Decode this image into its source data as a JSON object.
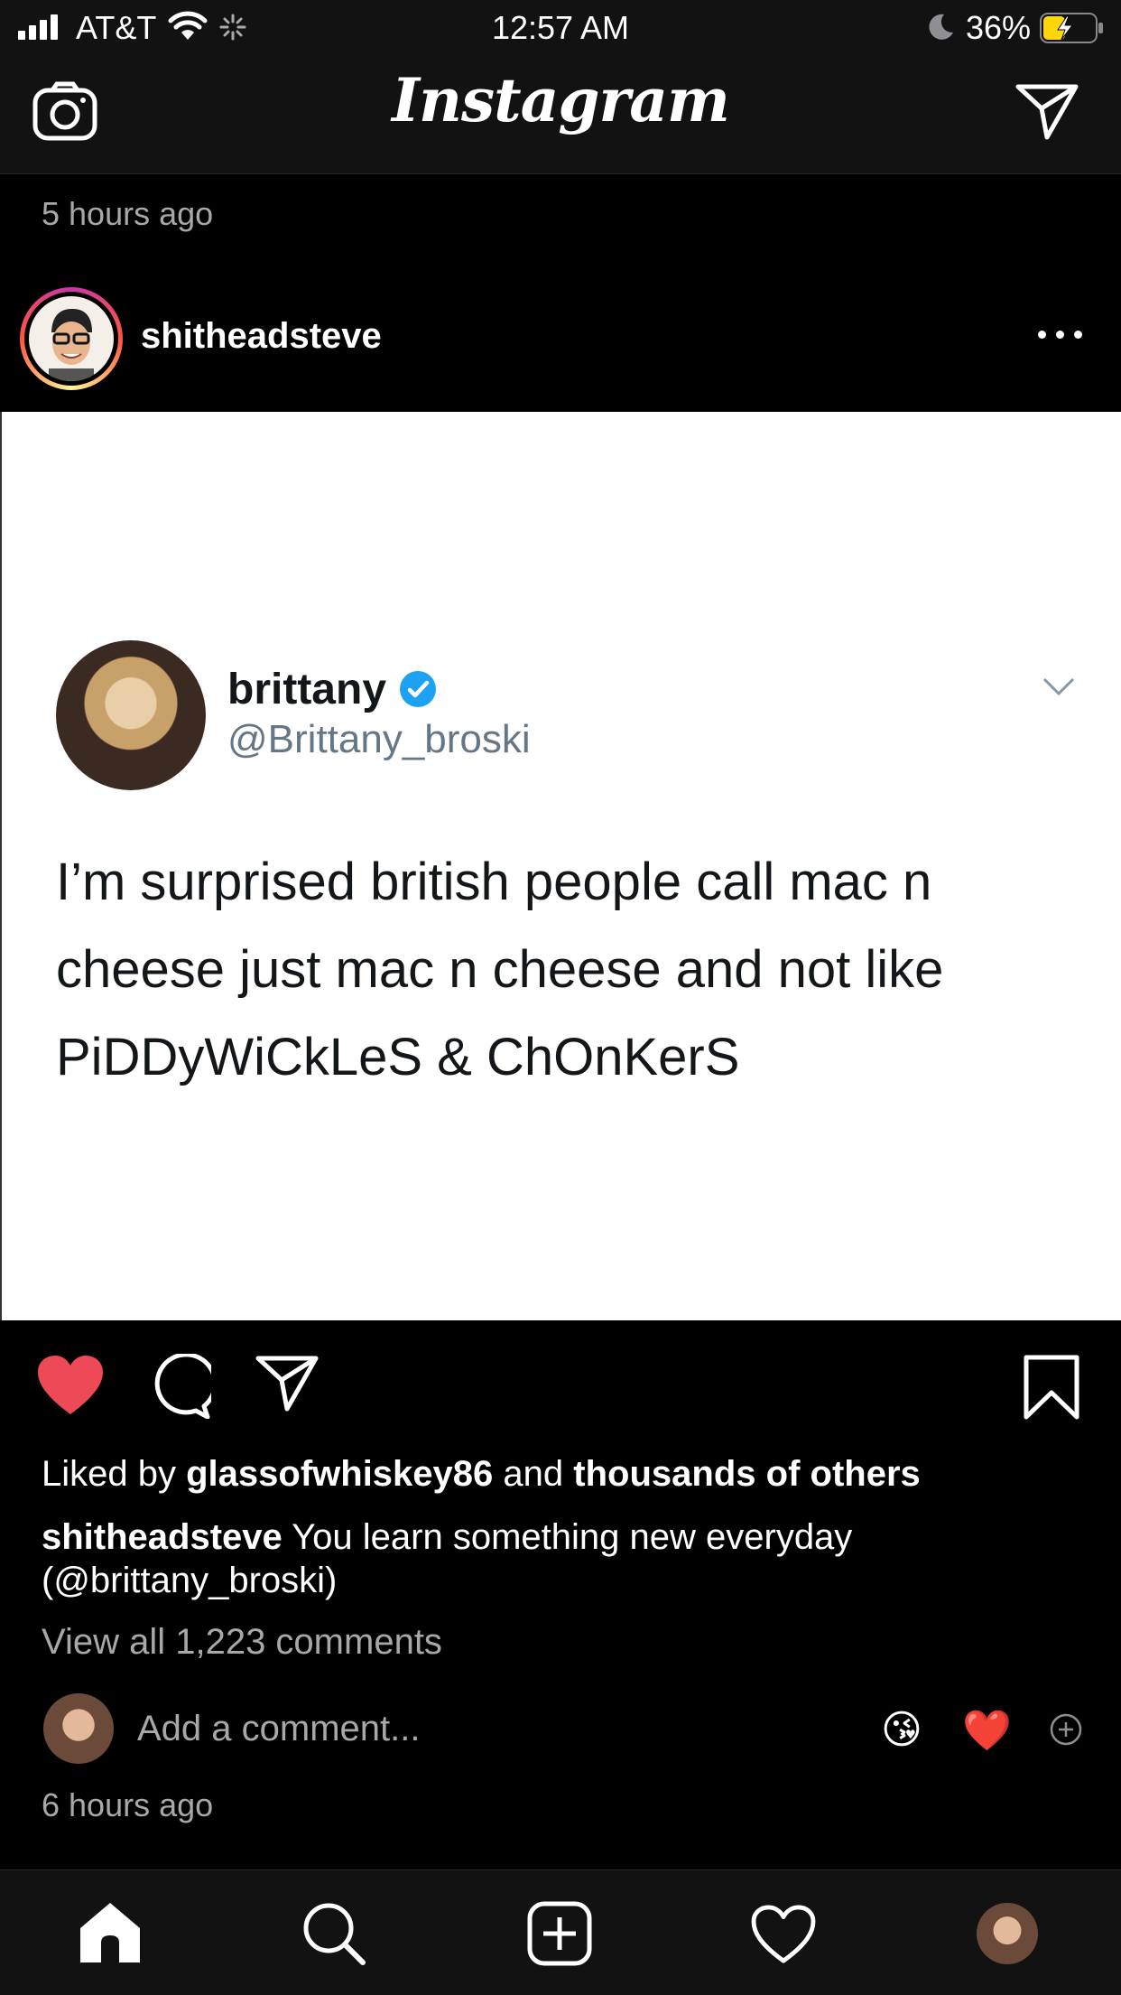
{
  "status_bar": {
    "carrier": "AT&T",
    "time": "12:57 AM",
    "battery": "36%"
  },
  "header": {
    "logo": "Instagram",
    "icons": [
      "camera-icon",
      "direct-message-icon"
    ]
  },
  "previous_post": {
    "timestamp": "5 hours ago"
  },
  "post": {
    "username": "shitheadsteve",
    "tweet": {
      "name": "brittany",
      "handle": "@Brittany_broski",
      "text": "I’m surprised british people call mac n cheese just mac n cheese and not like PiDDyWiCkLeS & ChOnKerS",
      "verified_color": "#1da1f2"
    },
    "liked": true,
    "like_color": "#ed4956",
    "likes": {
      "prefix": "Liked by",
      "user": "glassofwhiskey86",
      "and": "and",
      "others": "thousands of others"
    },
    "caption": {
      "user": "shitheadsteve",
      "text": "You learn something new everyday (@brittany_broski)"
    },
    "view_comments": "View all 1,223 comments",
    "add_comment_placeholder": "Add a comment...",
    "quick_reactions": [
      "😘",
      "❤️"
    ],
    "timestamp": "6 hours ago"
  },
  "bottom_nav": [
    "home-icon",
    "search-icon",
    "new-post-icon",
    "activity-icon",
    "profile-avatar"
  ]
}
